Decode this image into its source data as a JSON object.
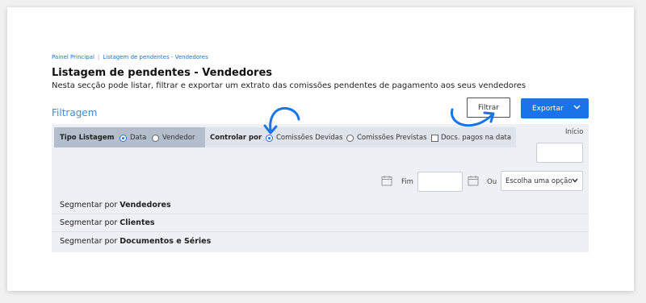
{
  "breadcrumb": {
    "items": [
      "Painel Principal",
      "Listagem de pendentes - Vendedores"
    ],
    "separator": "|"
  },
  "page": {
    "title": "Listagem de pendentes - Vendedores",
    "description": "Nesta secção pode listar, filtrar e exportar um extrato das comissões pendentes de pagamento aos seus vendedores"
  },
  "filter_section": {
    "title": "Filtragem",
    "filter_button": "Filtrar",
    "export_button": "Exportar"
  },
  "tipo_listagem": {
    "label": "Tipo Listagem",
    "options": [
      {
        "label": "Data",
        "selected": true
      },
      {
        "label": "Vendedor",
        "selected": false
      }
    ]
  },
  "controlar_por": {
    "label": "Controlar por",
    "options": [
      {
        "label": "Comissões Devidas",
        "selected": true
      },
      {
        "label": "Comissões Previstas",
        "selected": false
      }
    ],
    "checkbox": {
      "label": "Docs. pagos na data",
      "checked": false
    }
  },
  "dates": {
    "inicio_label": "Início",
    "fim_label": "Fim",
    "ou_label": "Ou",
    "select_value": "Escolha uma opção"
  },
  "segments": [
    {
      "prefix": "Segmentar por",
      "bold": "Vendedores"
    },
    {
      "prefix": "Segmentar por",
      "bold": "Clientes"
    },
    {
      "prefix": "Segmentar por",
      "bold": "Documentos e Séries"
    }
  ],
  "colors": {
    "accent": "#1a73e8",
    "annotation_arrow": "#1a73e8",
    "section_title": "#3e8ccf"
  }
}
